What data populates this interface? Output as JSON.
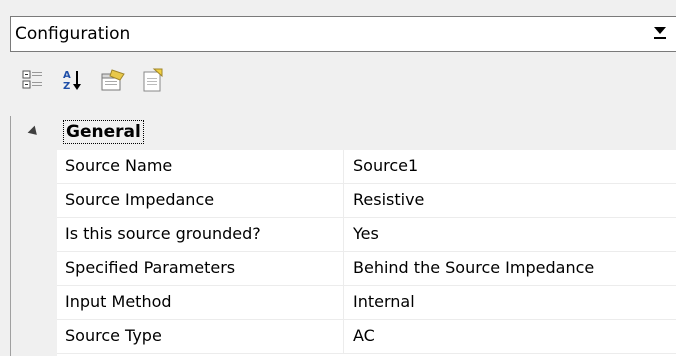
{
  "header": {
    "object_selector": "Configuration"
  },
  "toolbar": {
    "buttons": [
      {
        "icon": "categorized-icon",
        "tooltip": ""
      },
      {
        "icon": "alphabetical-sort-icon",
        "tooltip": ""
      },
      {
        "icon": "property-pages-icon",
        "tooltip": ""
      },
      {
        "icon": "events-icon",
        "tooltip": ""
      }
    ]
  },
  "grid": {
    "category": "General",
    "properties": [
      {
        "name": "Source Name",
        "value": "Source1"
      },
      {
        "name": "Source Impedance",
        "value": "Resistive"
      },
      {
        "name": "Is this source grounded?",
        "value": "Yes"
      },
      {
        "name": "Specified Parameters",
        "value": "Behind the Source Impedance"
      },
      {
        "name": "Input Method",
        "value": "Internal"
      },
      {
        "name": "Source Type",
        "value": "AC"
      }
    ]
  },
  "colors": {
    "background": "#f0f0f0",
    "grid_background": "#ffffff",
    "divider": "#ececec"
  }
}
